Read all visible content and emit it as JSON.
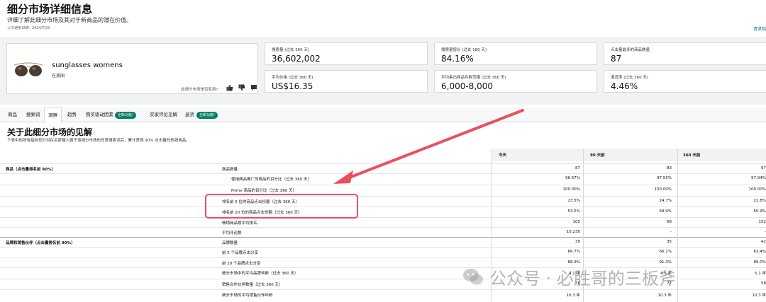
{
  "header": {
    "title": "细分市场详细信息",
    "subtitle": "详细了解此细分市场及其对于新商品的潜在价值。",
    "last_updated": "上次更新日期：2024/7/20",
    "right_link": "请求指"
  },
  "product": {
    "name": "sunglasses womens",
    "market": "在美国",
    "helpful_prompt": "此细分市场是否有用?"
  },
  "metrics": [
    {
      "label": "搜索量 (过去 360 天)",
      "value": "36,602,002"
    },
    {
      "label": "搜索量增长 (过去 180 天)",
      "value": "84.16%"
    },
    {
      "label": "点击量最多的商品数量",
      "value": "87"
    },
    {
      "label": "平均价格 (过去 360 天)",
      "value": "US$16.35"
    },
    {
      "label": "平均售出商品件数范围 (过去 360 天)",
      "value": "6,000-8,000"
    },
    {
      "label": "退货率 (过去 360 天)",
      "value": "4.46%"
    }
  ],
  "tabs": [
    {
      "label": "商品"
    },
    {
      "label": "搜索词"
    },
    {
      "label": "洞察"
    },
    {
      "label": "趋势"
    },
    {
      "label": "购买驱动因素"
    },
    {
      "label": "买家评论见解"
    },
    {
      "label": "退货"
    }
  ],
  "badges": {
    "new_feature": "全新功能!"
  },
  "insights": {
    "title": "关于此细分市场的见解",
    "description": "下表中的所有指标仅针对在买家输入属于该细分市场的任意搜索词后，累计获得 90% 点击量的热销商品。"
  },
  "table": {
    "columns": [
      "今天",
      "90 天前",
      "360 天前"
    ],
    "rows": [
      {
        "group": "商品（点击量排名前 90%）",
        "metric": "商品数量",
        "indent": false,
        "v1": "87",
        "v2": "83",
        "v3": "97"
      },
      {
        "group": "",
        "metric": "使用商品推广的商品的百分比（过去 360 天）",
        "indent": true,
        "v1": "96.67%",
        "v2": "97.59%",
        "v3": "97.94%"
      },
      {
        "group": "",
        "metric": "Prime 商品的百分比（过去 360 天）",
        "indent": true,
        "v1": "100.00%",
        "v2": "100.00%",
        "v3": "100.00%"
      },
      {
        "group": "",
        "metric": "排名前 5 位的商品点击份额（过去 360 天）",
        "indent": false,
        "v1": "23.5%",
        "v2": "24.7%",
        "v3": "22.8%"
      },
      {
        "group": "",
        "metric": "排名前 20 位的商品点击份额（过去 360 天）",
        "indent": false,
        "v1": "53.5%",
        "v2": "58.9%",
        "v3": "50.9%"
      },
      {
        "group": "",
        "metric": "畅销商品榜平均排名",
        "indent": false,
        "v1": "105",
        "v2": "68",
        "v3": "152"
      },
      {
        "group": "",
        "metric": "平均评论数",
        "indent": false,
        "v1": "10,230",
        "v2": "-",
        "v3": "-"
      },
      {
        "group": "品牌和销售伙伴（点击量排名前 90%）",
        "metric": "品牌数量",
        "indent": false,
        "v1": "39",
        "v2": "35",
        "v3": "42"
      },
      {
        "group": "",
        "metric": "前 5 个品牌点击分享",
        "indent": false,
        "v1": "66.7%",
        "v2": "66.1%",
        "v3": "63.4%"
      },
      {
        "group": "",
        "metric": "前 20 个品牌点击分享",
        "indent": false,
        "v1": "88.9%",
        "v2": "91.3%",
        "v3": "89.0%"
      },
      {
        "group": "",
        "metric": "细分市场中的平均品牌年龄（过去 360 天）",
        "indent": false,
        "v1": "4.1 年",
        "v2": "4.5 年",
        "v3": "5.1 年"
      },
      {
        "group": "",
        "metric": "销售合作伙伴数量（过去 360 天）",
        "indent": false,
        "v1": "76",
        "v2": "72",
        "v3": "58"
      },
      {
        "group": "",
        "metric": "细分市场的平均销售伙伴年龄",
        "indent": false,
        "v1": "10.3 年",
        "v2": "10.3 年",
        "v3": "10.3 年"
      }
    ]
  },
  "watermark": {
    "text": "公众号 · 必胜哥的三板斧"
  },
  "colors": {
    "accent_green": "#067d62",
    "highlight_red": "#e94f5f",
    "link": "#007185"
  }
}
